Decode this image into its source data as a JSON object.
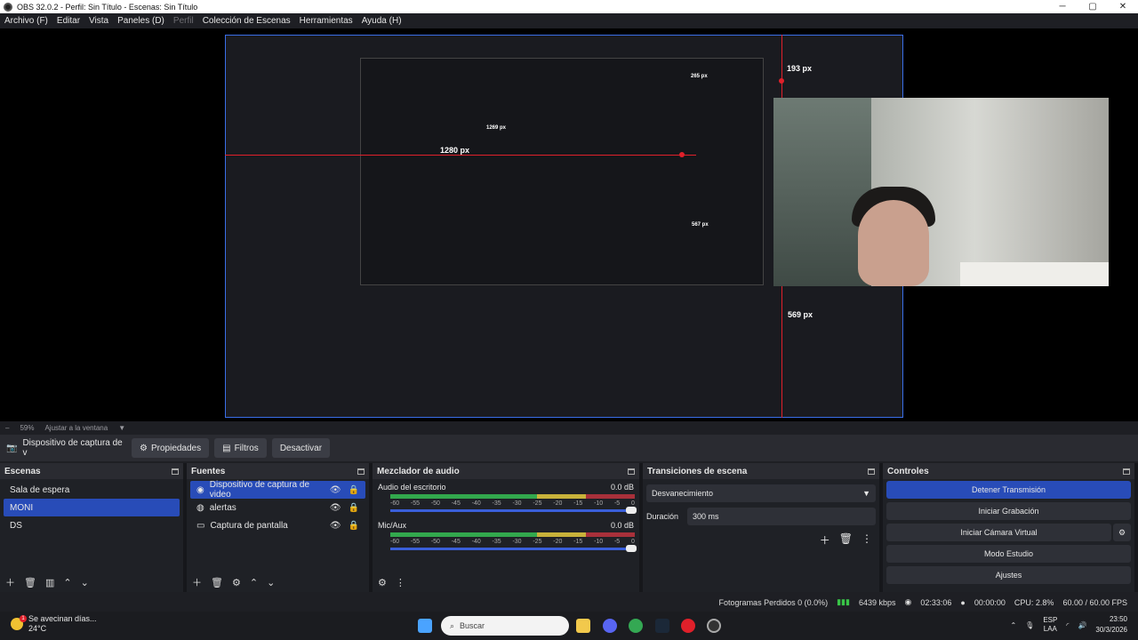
{
  "titlebar": {
    "title": "OBS 32.0.2 - Perfil: Sin Título - Escenas: Sin Título",
    "minimize": "─",
    "maximize": "▢",
    "close": "✕"
  },
  "menu": [
    "Archivo (F)",
    "Editar",
    "Vista",
    "Paneles (D)",
    "Perfil",
    "Colección de Escenas",
    "Herramientas",
    "Ayuda (H)"
  ],
  "preview": {
    "labels": {
      "top": "193 px",
      "left": "1280 px",
      "bottom": "569 px",
      "inner_top": "265 px",
      "inner_left": "1269 px",
      "inner_bottom": "567 px"
    }
  },
  "zoom": {
    "minus": "–",
    "value": "59%",
    "fit": "Ajustar a la ventana"
  },
  "source_bar": {
    "source_name": "Dispositivo de captura de v",
    "properties": "Propiedades",
    "filters": "Filtros",
    "deactivate": "Desactivar"
  },
  "scenes": {
    "title": "Escenas",
    "items": [
      "Sala de espera",
      "MONI",
      "DS"
    ],
    "selected": 1
  },
  "sources": {
    "title": "Fuentes",
    "items": [
      "Dispositivo de captura de video",
      "alertas",
      "Captura de pantalla"
    ],
    "selected": 0
  },
  "mixer": {
    "title": "Mezclador de audio",
    "channels": [
      {
        "name": "Audio del escritorio",
        "level": "0.0 dB"
      },
      {
        "name": "Mic/Aux",
        "level": "0.0 dB"
      }
    ],
    "scale": [
      "-60",
      "-55",
      "-50",
      "-45",
      "-40",
      "-35",
      "-30",
      "-25",
      "-20",
      "-15",
      "-10",
      "-5",
      "0"
    ]
  },
  "transitions": {
    "title": "Transiciones de escena",
    "selected": "Desvanecimiento",
    "duration_label": "Duración",
    "duration_value": "300 ms"
  },
  "controls": {
    "title": "Controles",
    "buttons": [
      "Detener Transmisión",
      "Iniciar Grabación",
      "Iniciar Cámara Virtual",
      "Modo Estudio",
      "Ajustes"
    ]
  },
  "status": {
    "dropped": "Fotogramas Perdidos 0 (0.0%)",
    "bitrate": "6439 kbps",
    "stream_time": "02:33:06",
    "rec_time": "00:00:00",
    "cpu": "CPU: 2.8%",
    "fps": "60.00 / 60.00 FPS"
  },
  "taskbar": {
    "weather_title": "Se avecinan días...",
    "weather_temp": "24°C",
    "weather_badge": "1",
    "search": "Buscar",
    "lang1": "ESP",
    "lang2": "LAA",
    "time": "23:50",
    "date": "30/3/2026"
  },
  "colors": {
    "accent": "#284cb8",
    "guide": "#e0202a",
    "meter_green": "#32a84d",
    "meter_yellow": "#c8b23a",
    "meter_red": "#a8303a"
  }
}
